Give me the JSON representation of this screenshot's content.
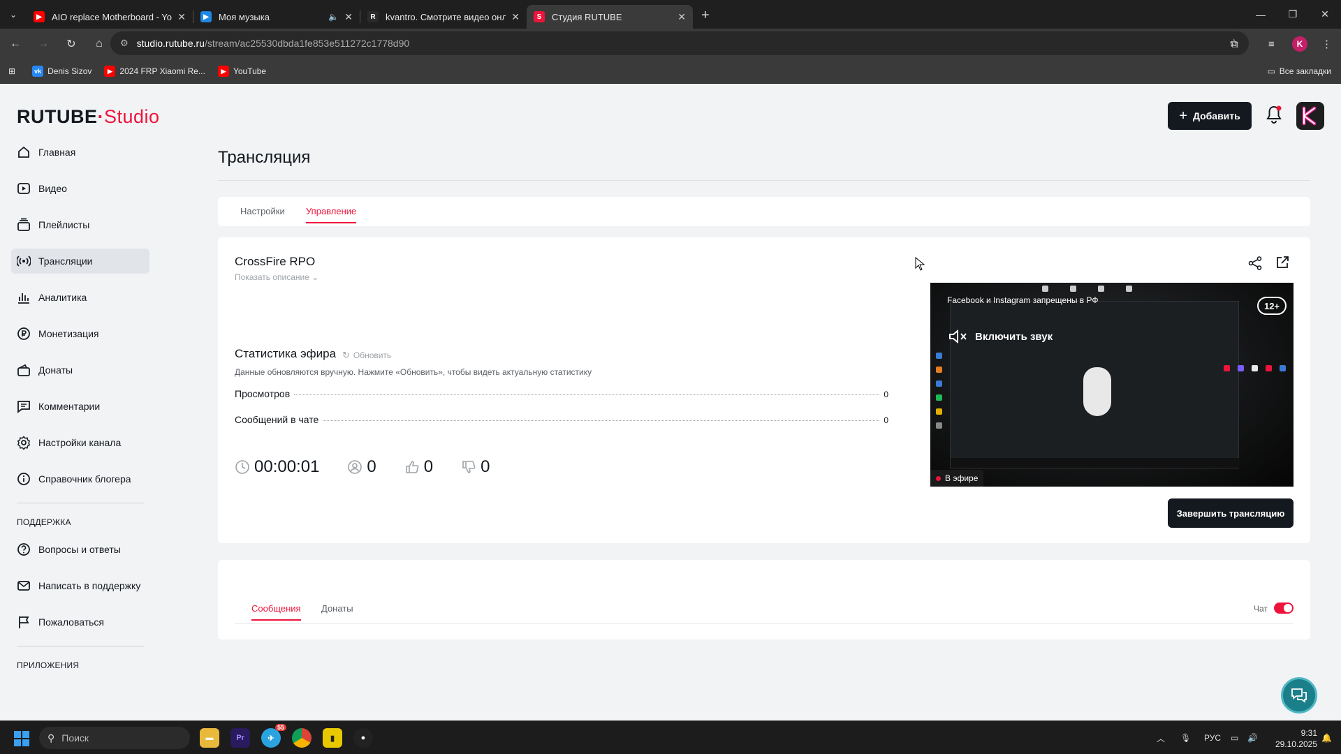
{
  "browser": {
    "tabs": [
      {
        "title": "AIO replace Motherboard - You",
        "icon_color": "#ff0000"
      },
      {
        "title": "Моя музыка",
        "icon_color": "#1e88e5"
      },
      {
        "title": "kvantro. Смотрите видео онла",
        "icon_color": "#2b2b2b"
      },
      {
        "title": "Студия RUTUBE",
        "icon_color": "#ed143b"
      }
    ],
    "url_host": "studio.rutube.ru",
    "url_path": "/stream/ac25530dbda1fe853e511272c1778d90",
    "bookmarks": [
      {
        "label": "Denis Sizov",
        "icon_color": "#2787f5",
        "icon_text": "vk"
      },
      {
        "label": "2024 FRP Xiaomi Re...",
        "icon_color": "#ff0000",
        "icon_text": "▶"
      },
      {
        "label": "YouTube",
        "icon_color": "#ff0000",
        "icon_text": "▶"
      }
    ],
    "all_bookmarks": "Все закладки"
  },
  "header": {
    "logo_main": "RUTUBE",
    "logo_sub": "Studio",
    "add_button": "Добавить",
    "avatar_letter": "K"
  },
  "sidebar": {
    "items": [
      {
        "label": "Главная",
        "icon": "home-icon"
      },
      {
        "label": "Видео",
        "icon": "video-icon"
      },
      {
        "label": "Плейлисты",
        "icon": "playlist-icon"
      },
      {
        "label": "Трансляции",
        "icon": "broadcast-icon",
        "active": true
      },
      {
        "label": "Аналитика",
        "icon": "analytics-icon"
      },
      {
        "label": "Монетизация",
        "icon": "monetization-icon"
      },
      {
        "label": "Донаты",
        "icon": "donate-icon"
      },
      {
        "label": "Комментарии",
        "icon": "comments-icon"
      },
      {
        "label": "Настройки канала",
        "icon": "gear-icon"
      },
      {
        "label": "Справочник блогера",
        "icon": "info-icon"
      }
    ],
    "support_heading": "ПОДДЕРЖКА",
    "support_items": [
      {
        "label": "Вопросы и ответы",
        "icon": "question-icon"
      },
      {
        "label": "Написать в поддержку",
        "icon": "mail-icon"
      },
      {
        "label": "Пожаловаться",
        "icon": "flag-icon"
      }
    ],
    "apps_heading": "ПРИЛОЖЕНИЯ"
  },
  "main": {
    "page_title": "Трансляция",
    "tabs": [
      {
        "label": "Настройки"
      },
      {
        "label": "Управление",
        "active": true
      }
    ],
    "stream": {
      "title": "CrossFire RPO",
      "show_description": "Показать описание",
      "stats_title": "Статистика эфира",
      "refresh_label": "Обновить",
      "stats_note": "Данные обновляются вручную. Нажмите «Обновить», чтобы видеть актуальную статистику",
      "stats": [
        {
          "label": "Просмотров",
          "value": "0"
        },
        {
          "label": "Сообщений в чате",
          "value": "0"
        }
      ],
      "duration": "00:00:01",
      "viewers": "0",
      "likes": "0",
      "dislikes": "0",
      "end_button": "Завершить трансляцию",
      "preview": {
        "banner": "Facebook и Instagram запрещены в РФ",
        "age_rating": "12+",
        "unmute_label": "Включить звук",
        "live_badge": "В эфире"
      }
    },
    "chat": {
      "tabs": [
        {
          "label": "Сообщения",
          "active": true
        },
        {
          "label": "Донаты"
        }
      ],
      "toggle_label": "Чат",
      "toggle_on": true
    }
  },
  "taskbar": {
    "search_placeholder": "Поиск",
    "lang": "РУС",
    "time": "9:31",
    "date": "29.10.2025",
    "telegram_badge": "55"
  }
}
